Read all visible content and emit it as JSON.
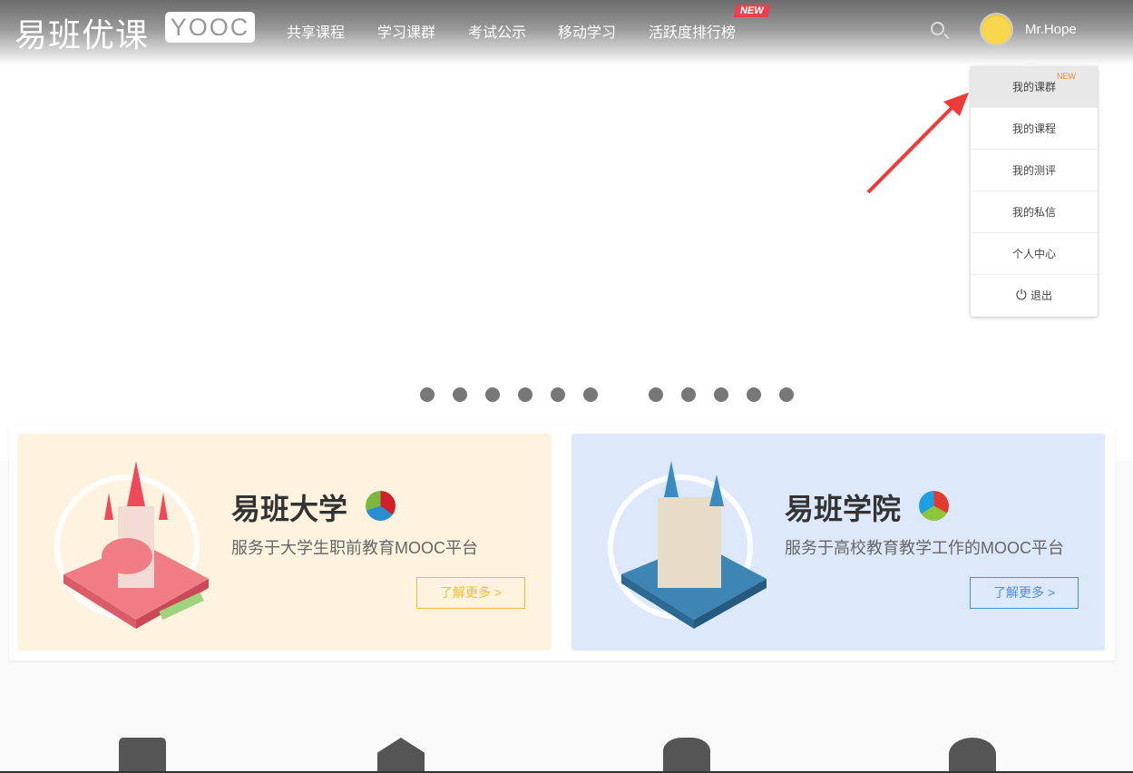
{
  "header": {
    "logo_cn": "易班优课",
    "logo_en": "YOOC",
    "nav": [
      "共享课程",
      "学习课群",
      "考试公示",
      "移动学习",
      "活跃度排行榜"
    ],
    "new_tag": "NEW",
    "username": "Mr.Hope"
  },
  "user_menu": {
    "items": [
      "我的课群",
      "我的课程",
      "我的测评",
      "我的私信",
      "个人中心",
      "退出"
    ],
    "new_tag": "NEW"
  },
  "carousel": {
    "dot_count": 11
  },
  "cards": [
    {
      "title": "易班大学",
      "desc": "服务于大学生职前教育MOOC平台",
      "button": "了解更多 >"
    },
    {
      "title": "易班学院",
      "desc": "服务于高校教育教学工作的MOOC平台",
      "button": "了解更多 >"
    }
  ],
  "colors": {
    "accent_red": "#e8424f",
    "orange": "#f5bb3c",
    "blue": "#4a8ee0"
  }
}
